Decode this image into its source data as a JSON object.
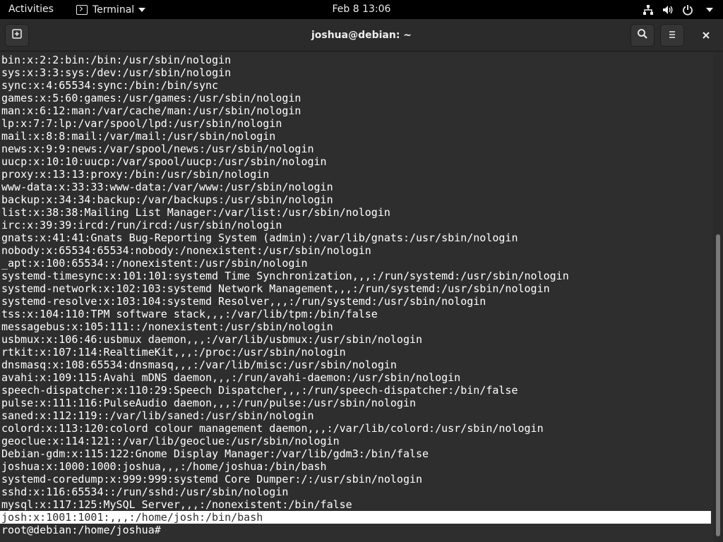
{
  "topbar": {
    "activities": "Activities",
    "app_name": "Terminal",
    "clock": "Feb 8  13:06"
  },
  "icons": {
    "terminal": "terminal-icon",
    "network": "network-icon",
    "volume": "volume-icon",
    "power": "power-icon",
    "new_tab": "new-tab-icon",
    "search": "search-icon",
    "menu": "hamburger-menu-icon",
    "close": "close-icon"
  },
  "window": {
    "title": "joshua@debian: ~"
  },
  "terminal": {
    "lines": [
      "bin:x:2:2:bin:/bin:/usr/sbin/nologin",
      "sys:x:3:3:sys:/dev:/usr/sbin/nologin",
      "sync:x:4:65534:sync:/bin:/bin/sync",
      "games:x:5:60:games:/usr/games:/usr/sbin/nologin",
      "man:x:6:12:man:/var/cache/man:/usr/sbin/nologin",
      "lp:x:7:7:lp:/var/spool/lpd:/usr/sbin/nologin",
      "mail:x:8:8:mail:/var/mail:/usr/sbin/nologin",
      "news:x:9:9:news:/var/spool/news:/usr/sbin/nologin",
      "uucp:x:10:10:uucp:/var/spool/uucp:/usr/sbin/nologin",
      "proxy:x:13:13:proxy:/bin:/usr/sbin/nologin",
      "www-data:x:33:33:www-data:/var/www:/usr/sbin/nologin",
      "backup:x:34:34:backup:/var/backups:/usr/sbin/nologin",
      "list:x:38:38:Mailing List Manager:/var/list:/usr/sbin/nologin",
      "irc:x:39:39:ircd:/run/ircd:/usr/sbin/nologin",
      "gnats:x:41:41:Gnats Bug-Reporting System (admin):/var/lib/gnats:/usr/sbin/nologin",
      "nobody:x:65534:65534:nobody:/nonexistent:/usr/sbin/nologin",
      "_apt:x:100:65534::/nonexistent:/usr/sbin/nologin",
      "systemd-timesync:x:101:101:systemd Time Synchronization,,,:/run/systemd:/usr/sbin/nologin",
      "systemd-network:x:102:103:systemd Network Management,,,:/run/systemd:/usr/sbin/nologin",
      "systemd-resolve:x:103:104:systemd Resolver,,,:/run/systemd:/usr/sbin/nologin",
      "tss:x:104:110:TPM software stack,,,:/var/lib/tpm:/bin/false",
      "messagebus:x:105:111::/nonexistent:/usr/sbin/nologin",
      "usbmux:x:106:46:usbmux daemon,,,:/var/lib/usbmux:/usr/sbin/nologin",
      "rtkit:x:107:114:RealtimeKit,,,:/proc:/usr/sbin/nologin",
      "dnsmasq:x:108:65534:dnsmasq,,,:/var/lib/misc:/usr/sbin/nologin",
      "avahi:x:109:115:Avahi mDNS daemon,,,:/run/avahi-daemon:/usr/sbin/nologin",
      "speech-dispatcher:x:110:29:Speech Dispatcher,,,:/run/speech-dispatcher:/bin/false",
      "pulse:x:111:116:PulseAudio daemon,,,:/run/pulse:/usr/sbin/nologin",
      "saned:x:112:119::/var/lib/saned:/usr/sbin/nologin",
      "colord:x:113:120:colord colour management daemon,,,:/var/lib/colord:/usr/sbin/nologin",
      "geoclue:x:114:121::/var/lib/geoclue:/usr/sbin/nologin",
      "Debian-gdm:x:115:122:Gnome Display Manager:/var/lib/gdm3:/bin/false",
      "joshua:x:1000:1000:joshua,,,:/home/joshua:/bin/bash",
      "systemd-coredump:x:999:999:systemd Core Dumper:/:/usr/sbin/nologin",
      "sshd:x:116:65534::/run/sshd:/usr/sbin/nologin",
      "mysql:x:117:125:MySQL Server,,,:/nonexistent:/bin/false"
    ],
    "highlighted_line": "josh:x:1001:1001:,,,:/home/josh:/bin/bash",
    "prompt": "root@debian:/home/joshua#"
  },
  "colors": {
    "terminal_bg": "#2e2e2e",
    "terminal_fg": "#ffffff",
    "headerbar_bg": "#2b2b2b",
    "topbar_bg": "#000000",
    "highlight_bg": "#ffffff",
    "highlight_fg": "#2e2e2e"
  }
}
